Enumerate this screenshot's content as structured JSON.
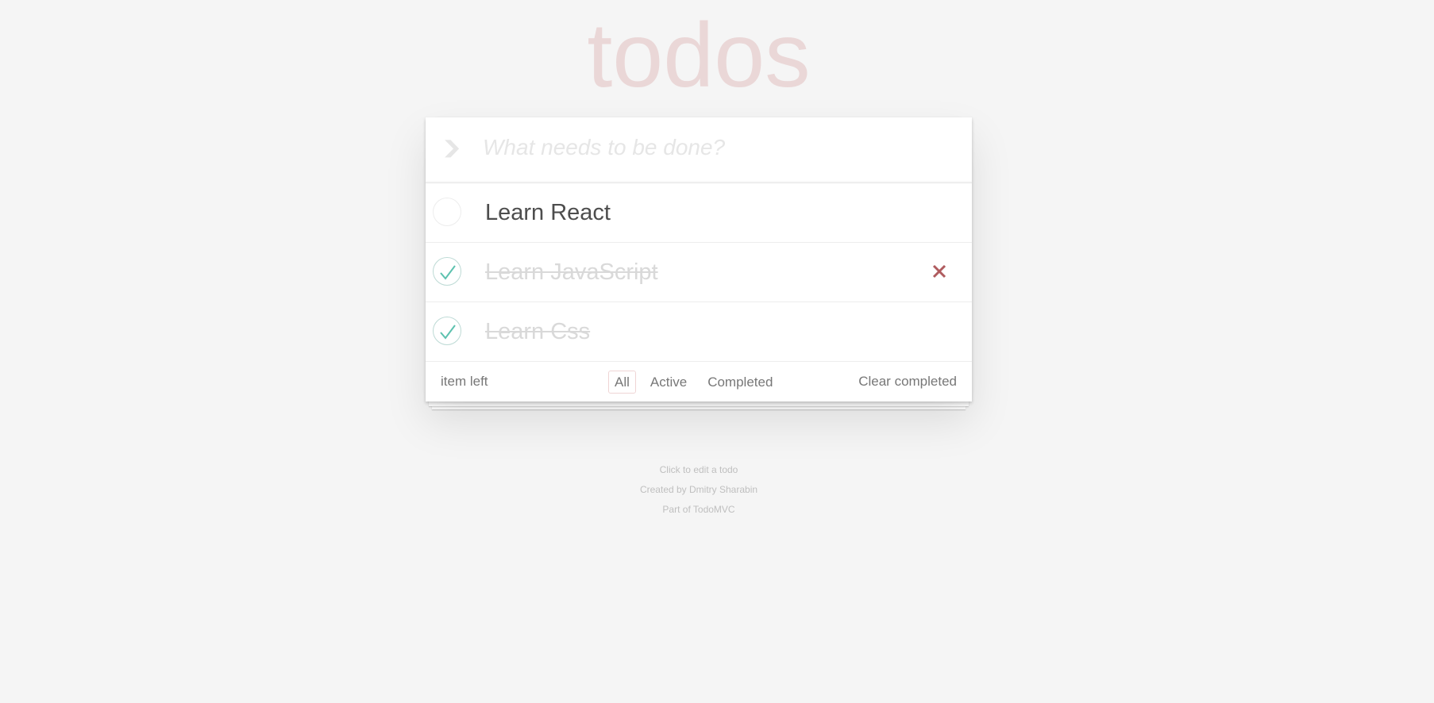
{
  "app": {
    "title": "todos"
  },
  "header": {
    "toggle_all_icon": "chevron-down-icon",
    "new_todo_placeholder": "What needs to be done?",
    "new_todo_value": ""
  },
  "todos": [
    {
      "label": "Learn React",
      "completed": false
    },
    {
      "label": "Learn JavaScript",
      "completed": true
    },
    {
      "label": "Learn Css",
      "completed": true
    }
  ],
  "footer": {
    "count_text": "item left",
    "filters": [
      {
        "label": "All",
        "selected": true
      },
      {
        "label": "Active",
        "selected": false
      },
      {
        "label": "Completed",
        "selected": false
      }
    ],
    "clear_completed_label": "Clear completed"
  },
  "info": {
    "line1": "Click to edit a todo",
    "line2": "Created by Dmitry Sharabin",
    "line3": "Part of TodoMVC"
  },
  "colors": {
    "background": "#f5f5f5",
    "title": "rgba(175,47,47,0.15)",
    "check": "#5dc2af",
    "destroy": "#af5b5e",
    "selected_filter_border": "rgba(175,47,47,0.2)"
  }
}
